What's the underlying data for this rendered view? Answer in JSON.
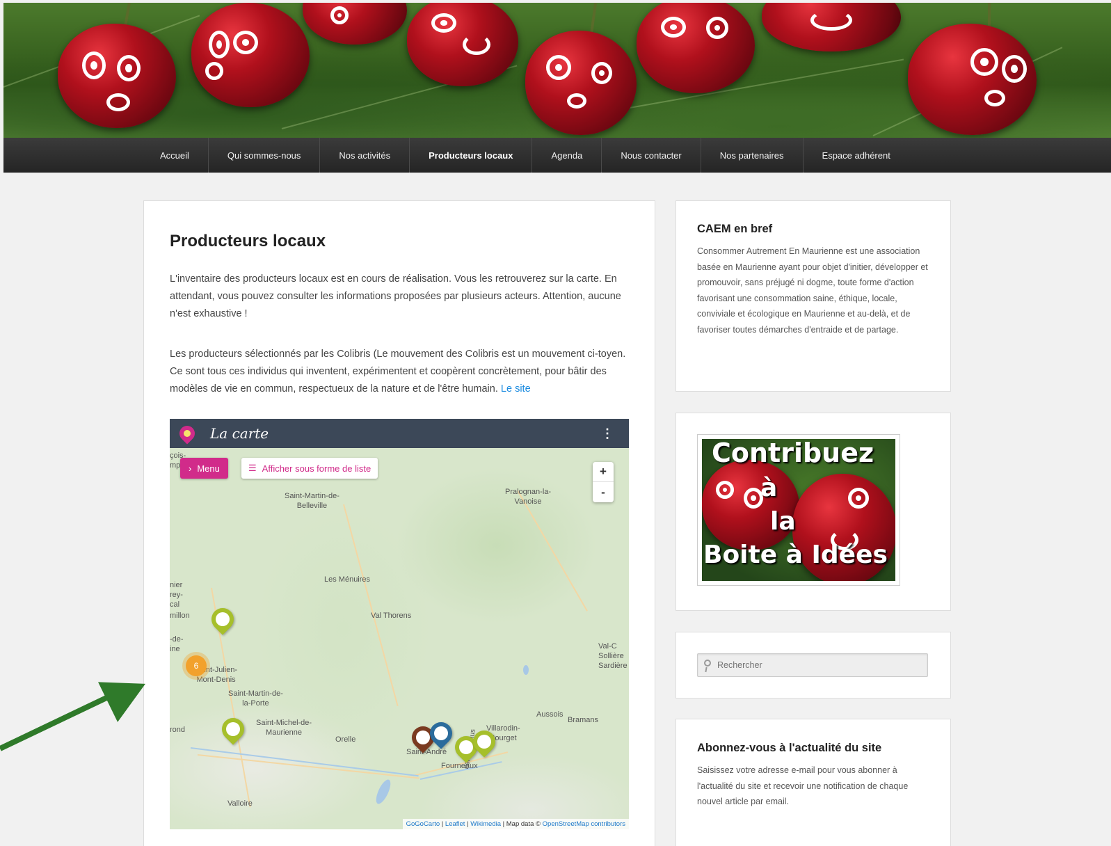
{
  "nav": {
    "items": [
      {
        "label": "Accueil"
      },
      {
        "label": "Qui sommes-nous"
      },
      {
        "label": "Nos activités"
      },
      {
        "label": "Producteurs locaux"
      },
      {
        "label": "Agenda"
      },
      {
        "label": "Nous contacter"
      },
      {
        "label": "Nos partenaires"
      },
      {
        "label": "Espace adhérent"
      }
    ],
    "active": "Producteurs locaux"
  },
  "main": {
    "title": "Producteurs locaux",
    "para1": "L'inventaire des producteurs locaux est en cours de réalisation. Vous les retrouverez sur la carte. En attendant, vous pouvez consulter les informations proposées par plusieurs acteurs. Attention, aucune n'est exhaustive !",
    "para2": "Les producteurs sélectionnés par les Colibris (Le mouvement des Colibris est un mouvement ci-toyen. Ce sont tous ces individus qui inventent, expérimentent et coopèrent concrètement, pour bâtir des modèles de vie en commun, respectueux de la nature et de l'être humain.",
    "para2_link": "Le site"
  },
  "map": {
    "title": "La carte",
    "menu_label": "Menu",
    "list_label": "Afficher sous forme de liste",
    "zoom_in": "+",
    "zoom_out": "-",
    "cluster_count": "6",
    "places": {
      "p1": "Saint-Martin-de-\nBelleville",
      "p2": "Pralognan-la-\nVanoise",
      "p3": "Les Ménuires",
      "p4": "Val Thorens",
      "p5": "Saint-Julien-\nMont-Denis",
      "p6": "Saint-Martin-de-\nla-Porte",
      "p7": "Saint-Michel-de-\nMaurienne",
      "p8": "Orelle",
      "p9": "Saint-André",
      "p10": "Fourneaux",
      "p11": "Villarodin-\nBourget",
      "p12": "Aussois",
      "p13": "Bramans",
      "p14": "Val-C\nSollière\nSardière",
      "p15": "Valloire",
      "p16": "çois-\nmp",
      "p17": "nier\nrey-\ncal",
      "p18": "millon",
      "p19": "-de-\nine",
      "p20": "rond",
      "p21": "nel du Fréjus"
    },
    "attribution": {
      "a1": "GoGoCarto",
      "a2": "Leaflet",
      "a3": "Wikimedia",
      "a4": "Map data ©",
      "a5": "OpenStreetMap contributors"
    }
  },
  "sidebar": {
    "about_title": "CAEM en bref",
    "about_text": "Consommer Autrement En Maurienne est une association basée en Maurienne ayant pour objet d'initier, développer et promouvoir, sans préjugé ni dogme, toute forme d'action favorisant une consommation saine, éthique, locale, conviviale et écologique en Maurienne et au-delà, et de favoriser toutes démarches d'entraide et de partage.",
    "ideas": {
      "line1": "Contribuez",
      "line2": "à",
      "line3": "la",
      "line4": "Boite à Idées"
    },
    "search_placeholder": "Rechercher",
    "subscribe_title": "Abonnez-vous à l'actualité du site",
    "subscribe_text": "Saisissez votre adresse e-mail pour vous abonner à l'actualité du site et recevoir une notification de chaque nouvel article par email."
  },
  "colors": {
    "nav_bg": "#2b2b2b",
    "link": "#1b8be0",
    "map_accent": "#d12b8a",
    "map_header": "#3c4858",
    "marker_green": "#a6bf2b",
    "cluster": "#f2a12c",
    "arrow": "#2f7a2a"
  }
}
